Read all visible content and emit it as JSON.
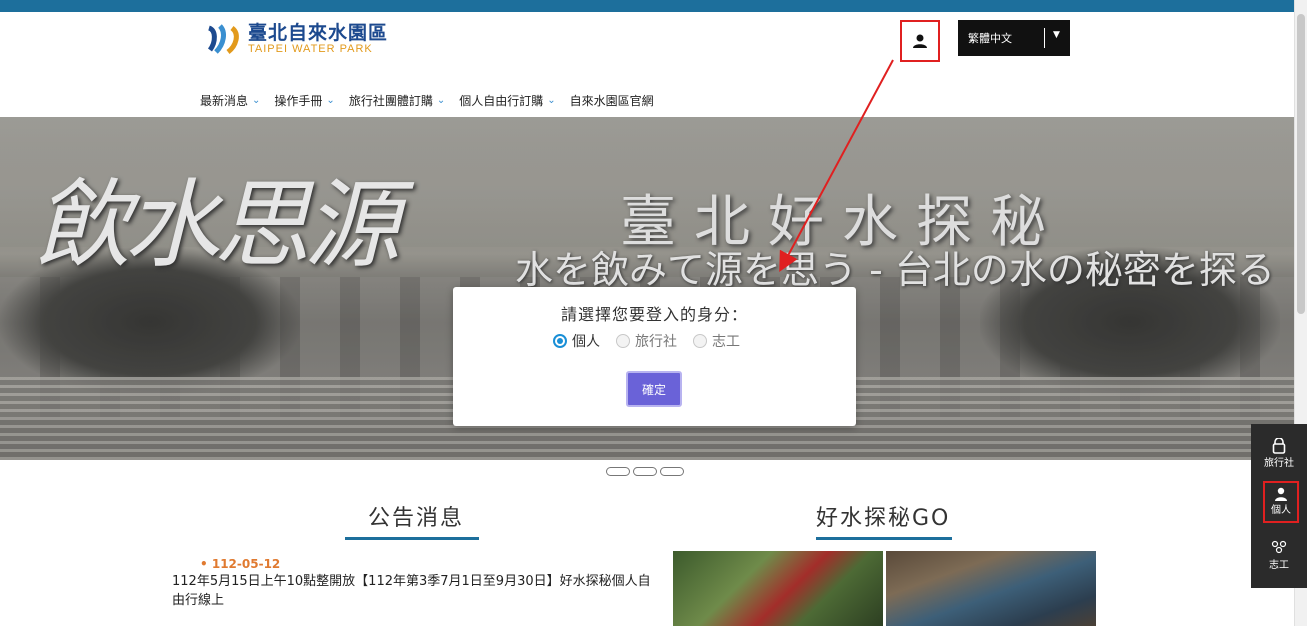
{
  "header": {
    "logo_cn": "臺北自來水園區",
    "logo_en": "Taipei Water Park",
    "language": "繁體中文"
  },
  "nav": [
    {
      "label": "最新消息",
      "has_dropdown": true
    },
    {
      "label": "操作手冊",
      "has_dropdown": true
    },
    {
      "label": "旅行社團體訂購",
      "has_dropdown": true
    },
    {
      "label": "個人自由行訂購",
      "has_dropdown": true
    },
    {
      "label": "自來水園區官網",
      "has_dropdown": false
    }
  ],
  "banner": {
    "calligraphy": "飲水思源",
    "title": "臺北好水探秘",
    "subtitle_jp": "水を飲みて源を思う - 台北の水の秘密を探る"
  },
  "modal": {
    "title": "請選擇您要登入的身分：",
    "options": [
      {
        "label": "個人",
        "checked": true
      },
      {
        "label": "旅行社",
        "checked": false
      },
      {
        "label": "志工",
        "checked": false
      }
    ],
    "confirm_label": "確定"
  },
  "sections": {
    "announcements_title": "公告消息",
    "explore_title": "好水探秘GO"
  },
  "news": [
    {
      "date": "112-05-12",
      "text": "112年5月15日上午10點整開放【112年第3季7月1日至9月30日】好水探秘個人自由行線上"
    }
  ],
  "side_panel": [
    {
      "label": "旅行社",
      "icon": "lock-bag-icon"
    },
    {
      "label": "個人",
      "icon": "person-icon",
      "active": true
    },
    {
      "label": "志工",
      "icon": "group-icon"
    }
  ],
  "colors": {
    "accent": "#1d6f9c",
    "button": "#6a62d8",
    "radio": "#1a8fd6",
    "highlight": "#e02020",
    "news_date": "#e07a30"
  }
}
